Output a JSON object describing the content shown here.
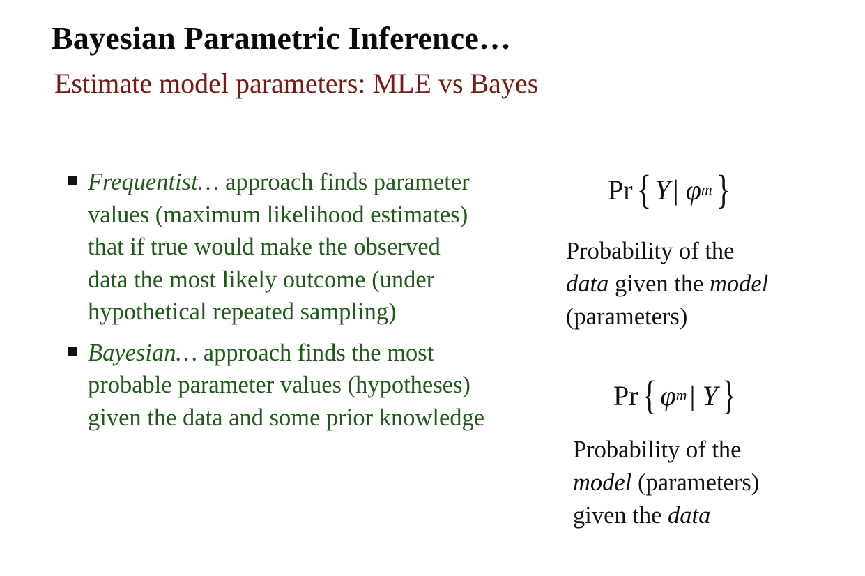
{
  "slide": {
    "title": "Bayesian Parametric Inference…",
    "subtitle": "Estimate model parameters: MLE vs Bayes"
  },
  "bullets": [
    {
      "lead": "Frequentist…",
      "text": " approach finds parameter values (maximum likelihood estimates) that if true would make the observed data the most likely outcome (under hypothetical repeated sampling)"
    },
    {
      "lead": "Bayesian…",
      "text": " approach finds the most probable parameter values (hypotheses) given the data and some prior knowledge"
    }
  ],
  "formulas": [
    {
      "pr": "Pr",
      "open": "{",
      "a": "Y",
      "sep": "|",
      "b": "φ",
      "b_sub": "m",
      "close": "}"
    },
    {
      "pr": "Pr",
      "open": "{",
      "a": "φ",
      "a_sub": "m",
      "sep": "|",
      "b": "Y",
      "close": "}"
    }
  ],
  "descriptions": [
    {
      "p1": "Probability of the",
      "p2_em": "data",
      "p2": " given the ",
      "p2_em2": "model",
      "p3": "(parameters)"
    },
    {
      "p1": "Probability of the",
      "p2_em": "model",
      "p2": " (parameters)",
      "p3": "given the ",
      "p3_em": "data"
    }
  ],
  "colors": {
    "title": "#0a0a0a",
    "subtitle": "#7a1a14",
    "bullet_text": "#1f5a1a",
    "formula_text": "#111111"
  }
}
